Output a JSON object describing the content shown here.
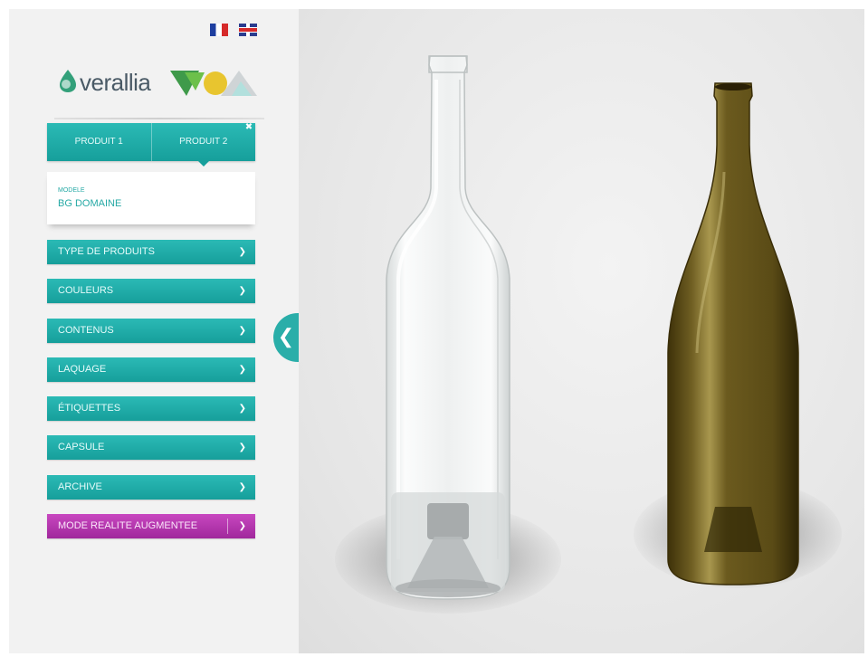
{
  "languages": [
    {
      "code": "fr",
      "icon": "flag-france-icon"
    },
    {
      "code": "en",
      "icon": "flag-uk-icon"
    }
  ],
  "brand": {
    "name": "verallia"
  },
  "tabs": [
    {
      "label": "PRODUIT 1",
      "active": false
    },
    {
      "label": "PRODUIT 2",
      "active": true
    }
  ],
  "model": {
    "label": "MODELE",
    "value": "BG DOMAINE"
  },
  "menu": [
    {
      "label": "TYPE DE PRODUITS"
    },
    {
      "label": "COULEURS"
    },
    {
      "label": "CONTENUS"
    },
    {
      "label": "LAQUAGE"
    },
    {
      "label": "ÉTIQUETTES"
    },
    {
      "label": "CAPSULE"
    },
    {
      "label": "ARCHIVE"
    },
    {
      "label": "MODE REALITE AUGMENTEE"
    }
  ],
  "colors": {
    "accent": "#1fb0ab",
    "ar_button": "#b338ae",
    "bottle_clear": "#f4f6f6",
    "bottle_brown": "#6b5a22"
  },
  "bottles": [
    {
      "name": "produit-1-bottle",
      "color": "clear"
    },
    {
      "name": "produit-2-bottle",
      "color": "brown"
    }
  ]
}
